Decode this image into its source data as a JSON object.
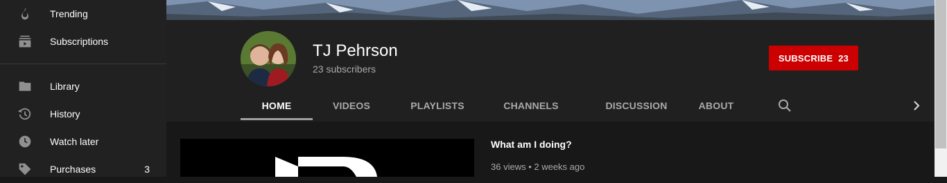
{
  "sidebar": {
    "items": [
      {
        "label": "Trending",
        "icon": "flame-icon"
      },
      {
        "label": "Subscriptions",
        "icon": "subscriptions-icon"
      },
      {
        "label": "Library",
        "icon": "folder-icon"
      },
      {
        "label": "History",
        "icon": "history-icon"
      },
      {
        "label": "Watch later",
        "icon": "clock-icon"
      },
      {
        "label": "Purchases",
        "icon": "tag-icon",
        "count": "3"
      }
    ]
  },
  "channel": {
    "name": "TJ Pehrson",
    "subscribers": "23 subscribers",
    "subscribe_label": "SUBSCRIBE",
    "subscribe_count": "23",
    "tabs": [
      "HOME",
      "VIDEOS",
      "PLAYLISTS",
      "CHANNELS",
      "DISCUSSION",
      "ABOUT"
    ],
    "active_tab": "HOME"
  },
  "featured_video": {
    "title": "What am I doing?",
    "meta": "36 views • 2 weeks ago"
  },
  "colors": {
    "subscribe_bg": "#cc0000",
    "sidebar_bg": "#212121",
    "header_bg": "#202020",
    "page_bg": "#181818"
  }
}
